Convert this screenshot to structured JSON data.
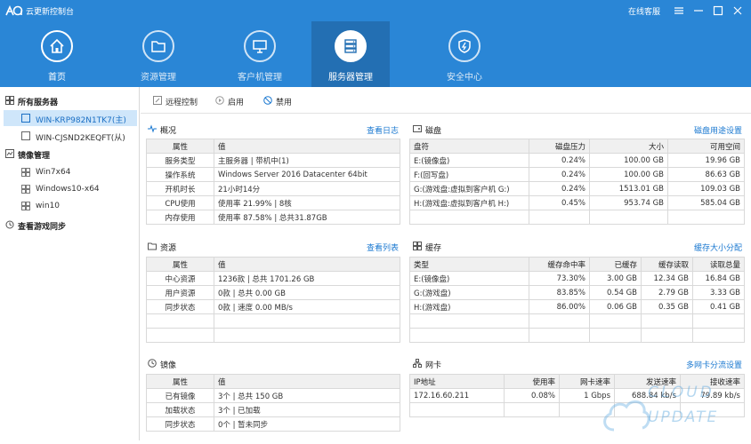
{
  "window": {
    "title": "云更新控制台",
    "online_service": "在线客服"
  },
  "nav": {
    "tabs": [
      {
        "label": "首页",
        "icon": "home-icon"
      },
      {
        "label": "资源管理",
        "icon": "folder-icon"
      },
      {
        "label": "客户机管理",
        "icon": "monitor-icon"
      },
      {
        "label": "服务器管理",
        "icon": "server-icon",
        "active": true
      },
      {
        "label": "安全中心",
        "icon": "shield-icon"
      }
    ]
  },
  "sidebar": {
    "server_group": "所有服务器",
    "servers": [
      {
        "label": "WIN-KRP982N1TK7(主)",
        "selected": true
      },
      {
        "label": "WIN-CJSND2KEQFT(从)"
      }
    ],
    "image_group": "镜像管理",
    "images": [
      "Win7x64",
      "Windows10-x64",
      "win10"
    ],
    "sync_group": "查看游戏同步"
  },
  "toolbar": {
    "remote_label": "远程控制",
    "enable_label": "启用",
    "disable_label": "禁用"
  },
  "overview": {
    "title": "概况",
    "link": "查看日志",
    "headers": [
      "属性",
      "值"
    ],
    "rows": [
      [
        "服务类型",
        "主服务器 | 带机中(1)"
      ],
      [
        "操作系统",
        "Windows Server 2016 Datacenter 64bit"
      ],
      [
        "开机时长",
        "21小时14分"
      ],
      [
        "CPU使用",
        "使用率 21.99% | 8核"
      ],
      [
        "内存使用",
        "使用率 87.58% | 总共31.87GB"
      ]
    ]
  },
  "disk": {
    "title": "磁盘",
    "link": "磁盘用途设置",
    "headers": [
      "盘符",
      "磁盘压力",
      "大小",
      "可用空间"
    ],
    "rows": [
      [
        "E:(镜像盘)",
        "0.24%",
        "100.00 GB",
        "19.96 GB"
      ],
      [
        "F:(回写盘)",
        "0.24%",
        "100.00 GB",
        "86.63 GB"
      ],
      [
        "G:(游戏盘:虚拟到客户机 G:)",
        "0.24%",
        "1513.01 GB",
        "109.03 GB"
      ],
      [
        "H:(游戏盘:虚拟到客户机 H:)",
        "0.45%",
        "953.74 GB",
        "585.04 GB"
      ]
    ]
  },
  "resource": {
    "title": "资源",
    "link": "查看列表",
    "headers": [
      "属性",
      "值"
    ],
    "rows": [
      [
        "中心资源",
        "1236款 | 总共 1701.26 GB"
      ],
      [
        "用户资源",
        "0款 | 总共 0.00 GB"
      ],
      [
        "同步状态",
        "0款 | 速度 0.00 MB/s"
      ]
    ]
  },
  "cache": {
    "title": "缓存",
    "link": "缓存大小分配",
    "headers": [
      "类型",
      "缓存命中率",
      "已缓存",
      "缓存读取",
      "读取总量"
    ],
    "rows": [
      [
        "E:(镜像盘)",
        "73.30%",
        "3.00 GB",
        "12.34 GB",
        "16.84 GB"
      ],
      [
        "G:(游戏盘)",
        "83.85%",
        "0.54 GB",
        "2.79 GB",
        "3.33 GB"
      ],
      [
        "H:(游戏盘)",
        "86.00%",
        "0.06 GB",
        "0.35 GB",
        "0.41 GB"
      ]
    ]
  },
  "mirror": {
    "title": "镜像",
    "headers": [
      "属性",
      "值"
    ],
    "rows": [
      [
        "已有镜像",
        "3个 | 总共 150 GB"
      ],
      [
        "加载状态",
        "3个 | 已加载"
      ],
      [
        "同步状态",
        "0个 | 暂未同步"
      ]
    ]
  },
  "nic": {
    "title": "网卡",
    "link": "多网卡分流设置",
    "headers": [
      "IP地址",
      "使用率",
      "网卡速率",
      "发送速率",
      "接收速率"
    ],
    "rows": [
      [
        "172.16.60.211",
        "0.08%",
        "1 Gbps",
        "688.84 kb/s",
        "79.89 kb/s"
      ]
    ]
  },
  "watermark": {
    "line1": "CLOUD",
    "line2": "UPDATE"
  },
  "colors": {
    "header_bg": "#2a86d6",
    "active_tab_bg": "#236fb3",
    "link": "#1a78d0",
    "selected_row": "#cfe6fa"
  }
}
